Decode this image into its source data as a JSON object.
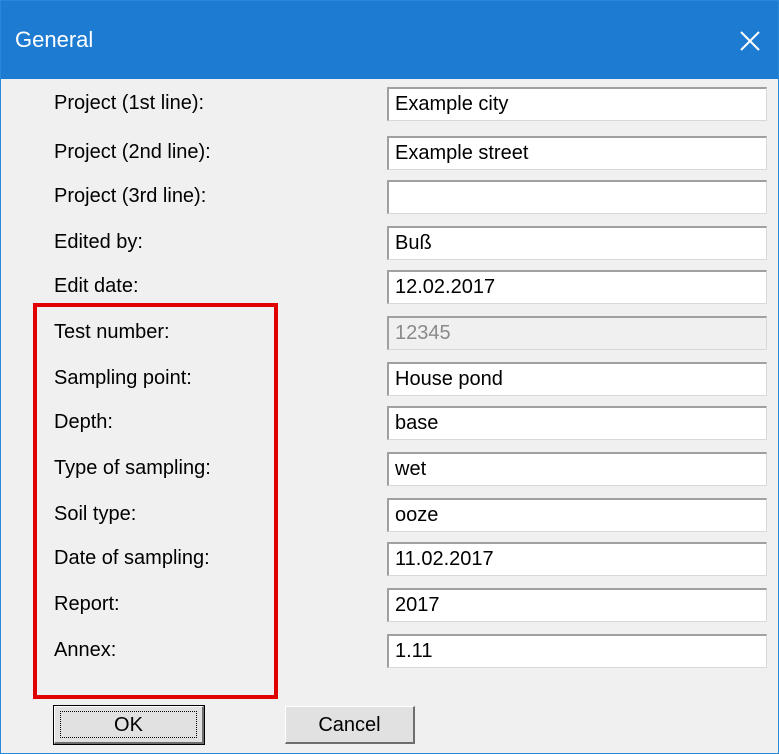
{
  "window": {
    "title": "General",
    "close_glyph": "close-icon"
  },
  "fields": [
    {
      "label": "Project (1st line):",
      "value": "Example city",
      "disabled": false
    },
    {
      "label": "Project (2nd line):",
      "value": "Example street",
      "disabled": false
    },
    {
      "label": "Project (3rd line):",
      "value": "",
      "disabled": false
    },
    {
      "label": "Edited by:",
      "value": "Buß",
      "disabled": false
    },
    {
      "label": "Edit date:",
      "value": "12.02.2017",
      "disabled": false
    },
    {
      "label": "Test number:",
      "value": "12345",
      "disabled": true
    },
    {
      "label": "Sampling point:",
      "value": "House pond",
      "disabled": false
    },
    {
      "label": "Depth:",
      "value": "base",
      "disabled": false
    },
    {
      "label": "Type of sampling:",
      "value": "wet",
      "disabled": false
    },
    {
      "label": "Soil type:",
      "value": "ooze",
      "disabled": false
    },
    {
      "label": "Date of sampling:",
      "value": "11.02.2017",
      "disabled": false
    },
    {
      "label": "Report:",
      "value": "2017",
      "disabled": false
    },
    {
      "label": "Annex:",
      "value": "1.11",
      "disabled": false
    }
  ],
  "buttons": {
    "ok_label": "OK",
    "cancel_label": "Cancel"
  },
  "colors": {
    "titlebar": "#1e7bd2",
    "highlight": "#e00000",
    "disabled_text": "#8a8a8a"
  }
}
